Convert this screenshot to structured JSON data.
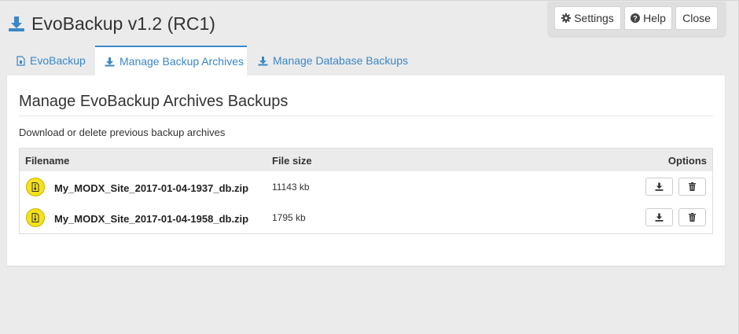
{
  "app": {
    "title": "EvoBackup v1.2 (RC1)"
  },
  "toolbar": {
    "settings_label": "Settings",
    "help_label": "Help",
    "close_label": "Close"
  },
  "tabs": [
    {
      "label": "EvoBackup",
      "icon": "file-icon",
      "active": false
    },
    {
      "label": "Manage Backup Archives",
      "icon": "download-icon",
      "active": true
    },
    {
      "label": "Manage Database Backups",
      "icon": "download-icon",
      "active": false
    }
  ],
  "panel": {
    "title": "Manage EvoBackup Archives Backups",
    "description": "Download or delete previous backup archives"
  },
  "table": {
    "columns": [
      "Filename",
      "File size",
      "Options"
    ],
    "rows": [
      {
        "filename": "My_MODX_Site_2017-01-04-1937_db.zip",
        "size": "11143 kb",
        "icon": "zip-file-icon"
      },
      {
        "filename": "My_MODX_Site_2017-01-04-1958_db.zip",
        "size": "1795 kb",
        "icon": "zip-file-icon"
      }
    ]
  },
  "colors": {
    "accent": "#3a87c8",
    "zip_badge": "#f5e21c",
    "background": "#ebebeb"
  }
}
